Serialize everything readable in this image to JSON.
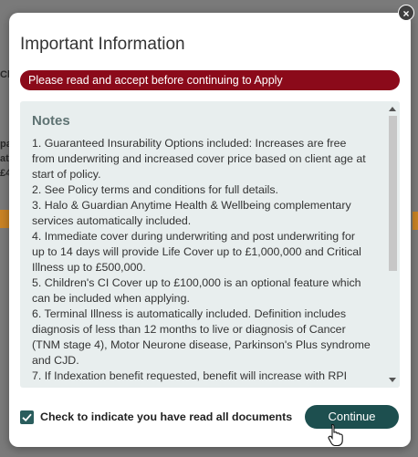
{
  "modal": {
    "title": "Important Information",
    "alert": "Please read and accept before continuing to Apply",
    "notes_heading": "Notes",
    "notes": [
      "1. Guaranteed Insurability Options included: Increases are free",
      "from underwriting and increased cover price based on client age at",
      "start of policy.",
      "2. See Policy terms and conditions for full details.",
      "3. Halo & Guardian Anytime Health & Wellbeing complementary",
      "services automatically included.",
      "4. Immediate cover during underwriting and post underwriting for",
      "up to 14 days will provide Life Cover up to £1,000,000 and Critical",
      "Illness up to £500,000.",
      "5. Children's CI Cover up to £100,000 is an optional feature which",
      "can be included when applying.",
      "6. Terminal Illness is automatically included. Definition includes",
      "diagnosis of less than 12 months to live or diagnosis of Cancer",
      "(TNM stage 4), Motor Neurone disease, Parkinson's Plus syndrome",
      "and CJD.",
      "7. If Indexation benefit requested, benefit will increase with RPI"
    ],
    "checkbox_label": "Check to indicate you have read all documents",
    "checkbox_checked": true,
    "continue_label": "Continue",
    "close_symbol": "×"
  },
  "background": {
    "fragments": [
      "Ch",
      "pa",
      "at",
      "£4"
    ]
  },
  "colors": {
    "alert_bg": "#8b0a1a",
    "primary": "#1d4f4f",
    "notes_bg": "#e8eeee",
    "notes_heading": "#5f7373"
  },
  "icons": {
    "close": "close-icon",
    "check": "check-icon",
    "cursor": "hand-pointer-icon",
    "scroll_up": "scroll-up-arrow-icon",
    "scroll_down": "scroll-down-arrow-icon"
  }
}
